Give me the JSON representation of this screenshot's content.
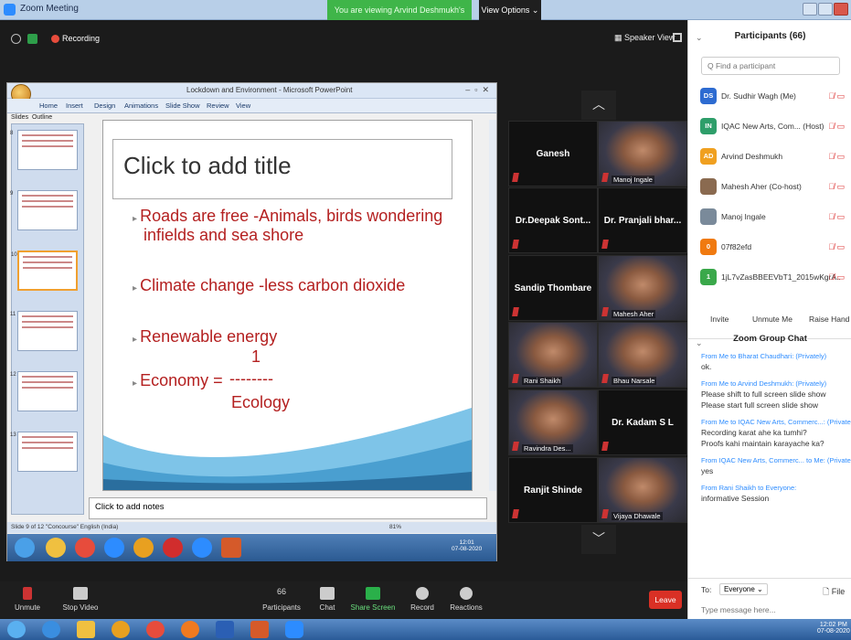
{
  "window": {
    "title": "Zoom Meeting",
    "viewing_banner": "You are viewing Arvind Deshmukh's screen",
    "view_options": "View Options ⌄"
  },
  "topbar": {
    "recording": "Recording",
    "speaker_view": "Speaker View"
  },
  "ppt": {
    "title": "Lockdown and Environment - Microsoft PowerPoint",
    "tabs": [
      "Home",
      "Insert",
      "Design",
      "Animations",
      "Slide Show",
      "Review",
      "View"
    ],
    "panel_tabs": [
      "Slides",
      "Outline"
    ],
    "slide_title": "Click to add title",
    "bullets": {
      "b1_l1": "Roads are free -Animals, birds wondering",
      "b1_l2": "infields and sea shore",
      "b2": "Climate change -less carbon dioxide",
      "b3": "Renewable energy",
      "numerator": "1",
      "b4": "Economy =",
      "dashes": "--------",
      "denominator": "Ecology"
    },
    "notes_placeholder": "Click to add notes",
    "status": "Slide 9 of 12   \"Concourse\"   English (India)",
    "zoom": "81%",
    "thumbnail_numbers": [
      "8",
      "9",
      "10",
      "11",
      "12",
      "13"
    ],
    "clock_time": "12:01",
    "clock_date": "07-08-2020"
  },
  "videos": [
    {
      "name": "Ganesh",
      "type": "name"
    },
    {
      "name": "Manoj Ingale",
      "type": "photo"
    },
    {
      "name": "Dr.Deepak Sont...",
      "type": "name"
    },
    {
      "name": "Dr. Pranjali bhar...",
      "type": "name"
    },
    {
      "name": "Sandip Thombare",
      "type": "name"
    },
    {
      "name": "Mahesh Aher",
      "type": "photo"
    },
    {
      "name": "Rani Shaikh",
      "type": "photo"
    },
    {
      "name": "Bhau Narsale",
      "type": "photo"
    },
    {
      "name": "Ravindra Des...",
      "type": "photo"
    },
    {
      "name": "Dr. Kadam S L",
      "type": "name"
    },
    {
      "name": "Ranjit Shinde",
      "type": "name"
    },
    {
      "name": "Vijaya Dhawale",
      "type": "photo"
    }
  ],
  "participants": {
    "header": "Participants (66)",
    "search_placeholder": "Q Find a participant",
    "list": [
      {
        "initials": "DS",
        "name": "Dr. Sudhir Wagh (Me)",
        "color": "#2d6bd1"
      },
      {
        "initials": "IN",
        "name": "IQAC New Arts, Com... (Host)",
        "color": "#2e9e6a"
      },
      {
        "initials": "AD",
        "name": "Arvind Deshmukh",
        "color": "#f0a020"
      },
      {
        "initials": "",
        "name": "Mahesh Aher (Co-host)",
        "color": "#8a6a50"
      },
      {
        "initials": "",
        "name": "Manoj Ingale",
        "color": "#7a8a9a"
      },
      {
        "initials": "0",
        "name": "07f82efd",
        "color": "#f07a10"
      },
      {
        "initials": "1",
        "name": "1jL7vZasBBEEVbT1_2015wKgrA...",
        "color": "#3aa84a"
      }
    ],
    "invite": "Invite",
    "unmute_me": "Unmute Me",
    "raise_hand": "Raise Hand"
  },
  "chat": {
    "header": "Zoom Group Chat",
    "messages": [
      {
        "meta": "From Me to Bharat Chaudhari: (Privately)",
        "text": "ok."
      },
      {
        "meta": "From Me to Arvind Deshmukh: (Privately)",
        "text": "Please shift to full screen slide show"
      },
      {
        "meta": "",
        "text": "Please start full screen slide show"
      },
      {
        "meta": "From Me to IQAC New Arts, Commerc...: (Privately)",
        "text": "Recording karat ahe ka tumhi?"
      },
      {
        "meta": "",
        "text": "Proofs kahi maintain karayache ka?"
      },
      {
        "meta": "From IQAC New Arts, Commerc... to Me: (Privately)",
        "text": "yes"
      },
      {
        "meta": "From Rani Shaikh to Everyone:",
        "text": "informative Session"
      }
    ],
    "to_label": "To:",
    "to_value": "Everyone ⌄",
    "file": "File",
    "message_placeholder": "Type message here..."
  },
  "toolbar": {
    "unmute": "Unmute",
    "stop_video": "Stop Video",
    "participants_count": "66",
    "participants": "Participants",
    "chat": "Chat",
    "share_screen": "Share Screen",
    "record": "Record",
    "reactions": "Reactions",
    "leave": "Leave"
  },
  "system_clock": {
    "time": "12:02 PM",
    "date": "07-08-2020"
  }
}
